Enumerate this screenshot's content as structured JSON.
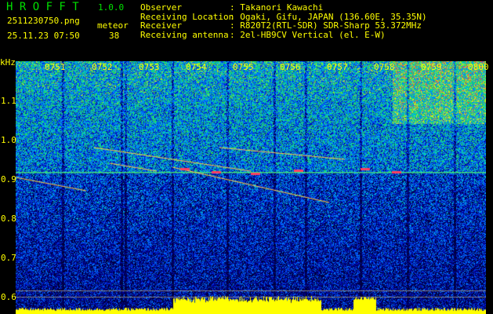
{
  "app": {
    "name": "H R O F F T",
    "version": "1.0.0"
  },
  "file": "2511230750.png",
  "datetime": "25.11.23 07:50",
  "meteor": {
    "label": "meteor",
    "count": "38"
  },
  "info": [
    {
      "label": "Observer",
      "value": ": Takanori Kawachi"
    },
    {
      "label": "Receiving Location",
      "value": ": Ogaki, Gifu, JAPAN (136.60E, 35.35N)"
    },
    {
      "label": "Receiver",
      "value": ": R820T2(RTL-SDR) SDR-Sharp 53.372MHz"
    },
    {
      "label": "Receiving antenna",
      "value": ": 2el-HB9CV Vertical (el. E-W)"
    }
  ],
  "y_axis": {
    "unit": "kHz",
    "ticks": [
      "1.1",
      "1.0",
      "0.9",
      "0.8",
      "0.7",
      "0.6"
    ]
  },
  "time_ticks": [
    "0751",
    "0752",
    "0753",
    "0754",
    "0755",
    "0756",
    "0757",
    "0758",
    "0759",
    "0800"
  ],
  "colors": {
    "text": "#ffff00",
    "title": "#00e000",
    "background": "#000000",
    "amplitude": "#ffff00"
  }
}
